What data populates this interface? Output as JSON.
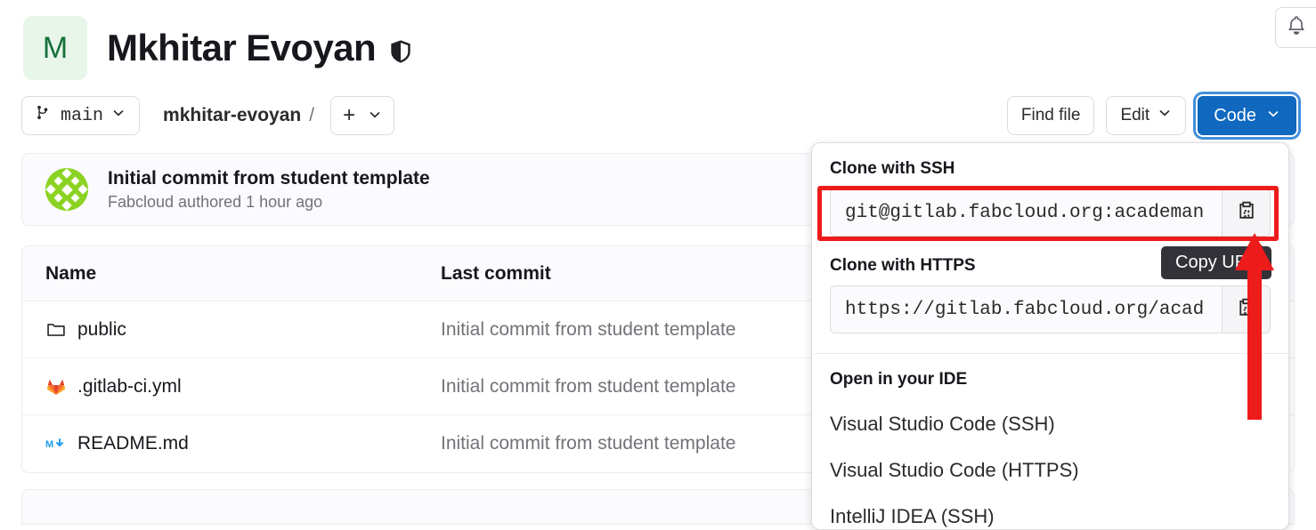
{
  "header": {
    "avatar_initial": "M",
    "title": "Mkhitar Evoyan",
    "visibility_icon": "shield-icon",
    "notification_icon": "bell-icon"
  },
  "toolbar": {
    "branch": "main",
    "branch_icon": "branch-icon",
    "breadcrumb_repo": "mkhitar-evoyan",
    "breadcrumb_sep": "/",
    "add_label": "+",
    "find_file": "Find file",
    "edit": "Edit",
    "code": "Code"
  },
  "commit": {
    "message": "Initial commit from student template",
    "meta": "Fabcloud authored 1 hour ago",
    "avatar_icon": "identicon-avatar"
  },
  "files": {
    "columns": [
      "Name",
      "Last commit"
    ],
    "rows": [
      {
        "name": "public",
        "icon": "folder-icon",
        "last_commit": "Initial commit from student template"
      },
      {
        "name": ".gitlab-ci.yml",
        "icon": "gitlab-icon",
        "last_commit": "Initial commit from student template"
      },
      {
        "name": "README.md",
        "icon": "markdown-icon",
        "last_commit": "Initial commit from student template"
      }
    ]
  },
  "code_dropdown": {
    "ssh_label": "Clone with SSH",
    "ssh_url": "git@gitlab.fabcloud.org:academan",
    "https_label": "Clone with HTTPS",
    "https_url": "https://gitlab.fabcloud.org/acad",
    "copy_icon": "copy-icon",
    "ide_label": "Open in your IDE",
    "ide_items": [
      "Visual Studio Code (SSH)",
      "Visual Studio Code (HTTPS)",
      "IntelliJ IDEA (SSH)"
    ]
  },
  "annotation": {
    "tooltip": "Copy URL",
    "highlight_color": "#ee1b1b",
    "arrow_icon": "up-arrow-annotation"
  },
  "colors": {
    "primary": "#1068bf",
    "avatar_bg": "#e8f5e9",
    "avatar_fg": "#15713a",
    "muted": "#737278"
  }
}
